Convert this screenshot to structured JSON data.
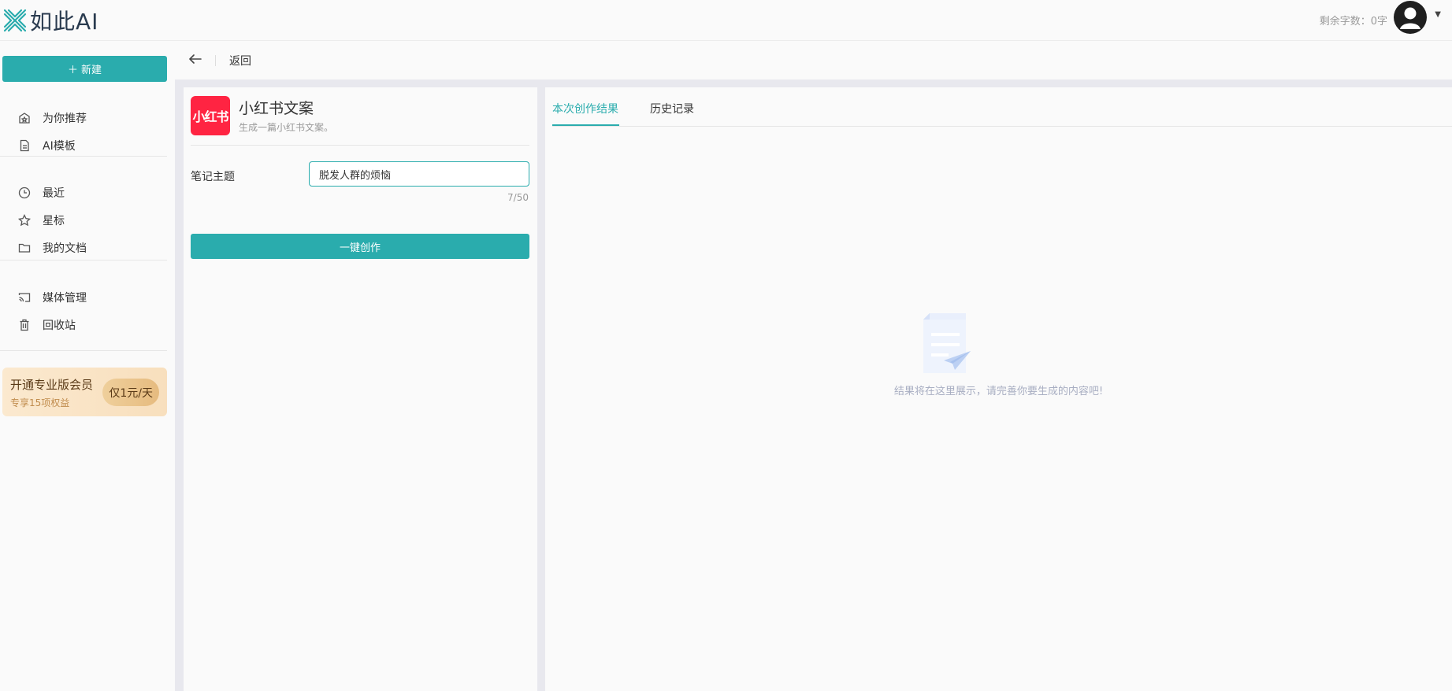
{
  "app": {
    "logo_text": "如此AI"
  },
  "header": {
    "quota": "剩余字数：0字"
  },
  "sidebar": {
    "new_label": "新建",
    "items": [
      {
        "label": "为你推荐",
        "icon": "home-star-icon"
      },
      {
        "label": "AI模板",
        "icon": "document-icon"
      },
      {
        "label": "最近",
        "icon": "clock-icon"
      },
      {
        "label": "星标",
        "icon": "star-icon"
      },
      {
        "label": "我的文档",
        "icon": "folder-icon"
      },
      {
        "label": "媒体管理",
        "icon": "cast-icon"
      },
      {
        "label": "回收站",
        "icon": "trash-icon"
      }
    ],
    "promo": {
      "title": "开通专业版会员",
      "subtitle": "专享15项权益",
      "price": "仅1元/天"
    }
  },
  "backbar": {
    "label": "返回"
  },
  "tool": {
    "icon_text": "小红书",
    "title": "小红书文案",
    "description": "生成一篇小红书文案。",
    "field_label": "笔记主题",
    "field_value": "脱发人群的烦恼",
    "field_count": "7/50",
    "submit_label": "一键创作"
  },
  "result": {
    "tabs": [
      {
        "label": "本次创作结果"
      },
      {
        "label": "历史记录"
      }
    ],
    "empty_text": "结果将在这里展示，请完善你要生成的内容吧!"
  },
  "colors": {
    "accent": "#2aacad",
    "brand_red": "#ff2442"
  }
}
